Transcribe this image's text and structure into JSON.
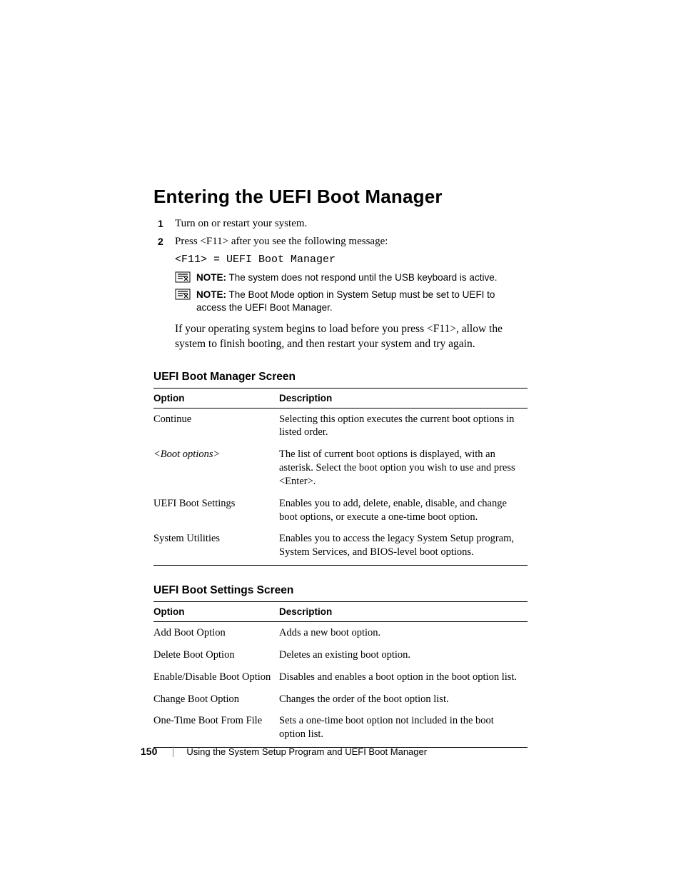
{
  "heading": "Entering the UEFI Boot Manager",
  "steps": {
    "s1_num": "1",
    "s1_text": "Turn on or restart your system.",
    "s2_num": "2",
    "s2_text": "Press <F11> after you see the following message:"
  },
  "code_line": "<F11> = UEFI Boot Manager",
  "note1": {
    "label": "NOTE:",
    "text": " The system does not respond until the USB keyboard is active."
  },
  "note2": {
    "label": "NOTE:",
    "text": " The Boot Mode option in System Setup must be set to UEFI to access the UEFI Boot Manager."
  },
  "para_after": "If your operating system begins to load before you press <F11>, allow the system to finish booting, and then restart your system and try again.",
  "table1": {
    "title": "UEFI Boot Manager Screen",
    "h_option": "Option",
    "h_desc": "Description",
    "rows": {
      "r0_opt": "Continue",
      "r0_desc": "Selecting this option executes the current boot options in listed order.",
      "r1_opt": "<Boot options>",
      "r1_desc": "The list of current boot options is displayed, with an asterisk. Select the boot option you wish to use and press <Enter>.",
      "r2_opt": "UEFI Boot Settings",
      "r2_desc": "Enables you to add, delete, enable, disable, and change boot options, or execute a one-time boot option.",
      "r3_opt": "System Utilities",
      "r3_desc": "Enables you to access the legacy System Setup program, System Services, and BIOS-level boot options."
    }
  },
  "table2": {
    "title": "UEFI Boot Settings Screen",
    "h_option": "Option",
    "h_desc": "Description",
    "rows": {
      "r0_opt": "Add Boot Option",
      "r0_desc": "Adds a new boot option.",
      "r1_opt": "Delete Boot Option",
      "r1_desc": "Deletes an existing boot option.",
      "r2_opt": "Enable/Disable Boot Option",
      "r2_desc": "Disables and enables a boot option in the boot option list.",
      "r3_opt": "Change Boot Option",
      "r3_desc": "Changes the order of the boot option list.",
      "r4_opt": "One-Time Boot From File",
      "r4_desc": "Sets a one-time boot option not included in the boot option list."
    }
  },
  "footer": {
    "page_number": "150",
    "section": "Using the System Setup Program and UEFI Boot Manager"
  }
}
